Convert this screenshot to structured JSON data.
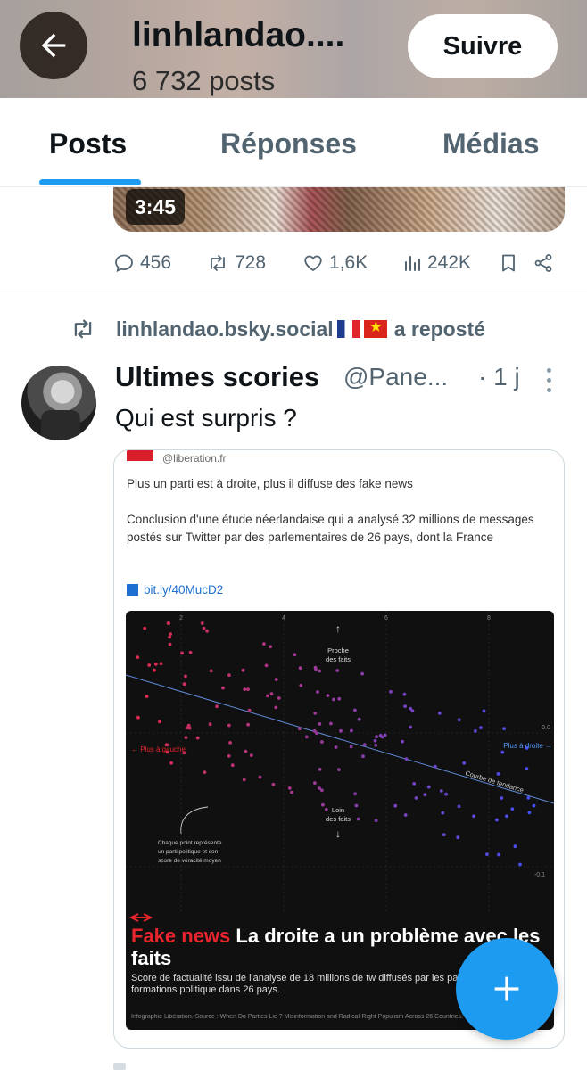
{
  "header": {
    "title": "linhlandao....",
    "post_count": "6 732 posts",
    "follow_label": "Suivre",
    "back_icon": "arrow-left-icon"
  },
  "tabs": [
    {
      "label": "Posts",
      "active": true
    },
    {
      "label": "Réponses",
      "active": false
    },
    {
      "label": "Médias",
      "active": false
    }
  ],
  "accent_color": "#1d9bf0",
  "previous_post": {
    "video_duration": "3:45",
    "actions": {
      "replies": "456",
      "reposts": "728",
      "likes": "1,6K",
      "views": "242K"
    }
  },
  "repost": {
    "by": "linhlandao.bsky.social",
    "suffix": "a reposté",
    "flags": [
      "fr-flag",
      "vn-flag"
    ]
  },
  "post": {
    "author": "Ultimes scories",
    "handle": "@Pane...",
    "time": "· 1 j",
    "text": "Qui est surpris ?",
    "image": {
      "source_handle": "@liberation.fr",
      "headline": "Plus un parti est à droite, plus il diffuse des fake news",
      "body": "Conclusion d'une étude néerlandaise qui a analysé 32 millions de messages postés sur Twitter par des parlementaires de 26 pays, dont la France",
      "link": "bit.ly/40MucD2",
      "chart": {
        "x_ticks": [
          "2",
          "4",
          "6",
          "8"
        ],
        "y_ticks": [
          "0.0",
          "-0.1"
        ],
        "label_top": "Proche des faits",
        "label_bottom": "Loin des faits",
        "label_left": "← Plus à gauche",
        "label_right": "Plus à droite →",
        "trend_label": "Courbe de tendance",
        "note": "Chaque point représente un parti politique et son score de véracité moyen"
      },
      "title_red": "Fake news",
      "title_rest": "La droite a un problème avec les faits",
      "subtitle": "Score de factualité issu de l'analyse de 18 millions de tw diffusés par les parlementaires de formations politique dans 26 pays.",
      "source_note": "Infographie Libération. Source : When Do Parties Lie ? Misinformation and Radical-Right Populism Across 26 Countries. Positionnement gauche-droite : échelle de la plateforme ParlGov."
    }
  },
  "fab_icon": "plus-icon"
}
